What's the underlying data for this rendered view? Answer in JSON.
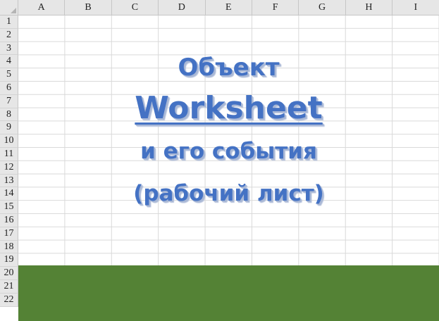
{
  "columns": [
    "A",
    "B",
    "C",
    "D",
    "E",
    "F",
    "G",
    "H",
    "I"
  ],
  "rows": [
    "1",
    "2",
    "3",
    "4",
    "5",
    "6",
    "7",
    "8",
    "9",
    "10",
    "11",
    "12",
    "13",
    "14",
    "15",
    "16",
    "17",
    "18",
    "19",
    "20",
    "21",
    "22"
  ],
  "title": {
    "line1": "Объект",
    "line2": "Worksheet",
    "line3": "и его события",
    "line4": "(рабочий лист)"
  },
  "colors": {
    "title_text": "#4472c4",
    "band": "#548235",
    "header_bg": "#e6e6e6",
    "gridline": "#d9d9d9"
  }
}
